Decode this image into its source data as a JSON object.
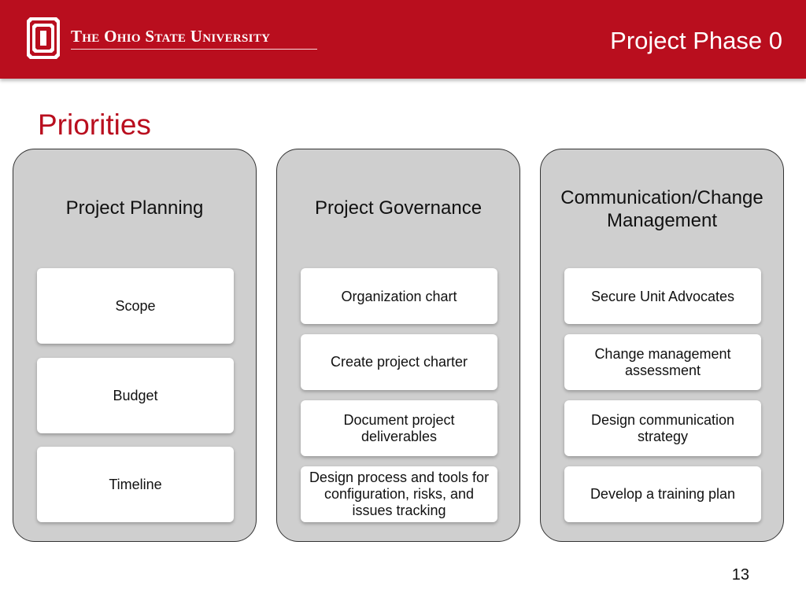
{
  "header": {
    "university": "The Ohio State University",
    "title": "Project Phase 0",
    "brand_color": "#b90e1e",
    "logo_icon": "block-o-logo-icon"
  },
  "page": {
    "title": "Priorities",
    "number": "13"
  },
  "columns": [
    {
      "heading": "Project Planning",
      "items": [
        "Scope",
        "Budget",
        "Timeline"
      ]
    },
    {
      "heading": "Project Governance",
      "items": [
        "Organization chart",
        "Create project charter",
        "Document project deliverables",
        "Design process and tools for configuration, risks, and issues tracking"
      ]
    },
    {
      "heading": "Communication/Change Management",
      "items": [
        "Secure Unit Advocates",
        "Change management assessment",
        "Design communication strategy",
        "Develop a training plan"
      ]
    }
  ]
}
